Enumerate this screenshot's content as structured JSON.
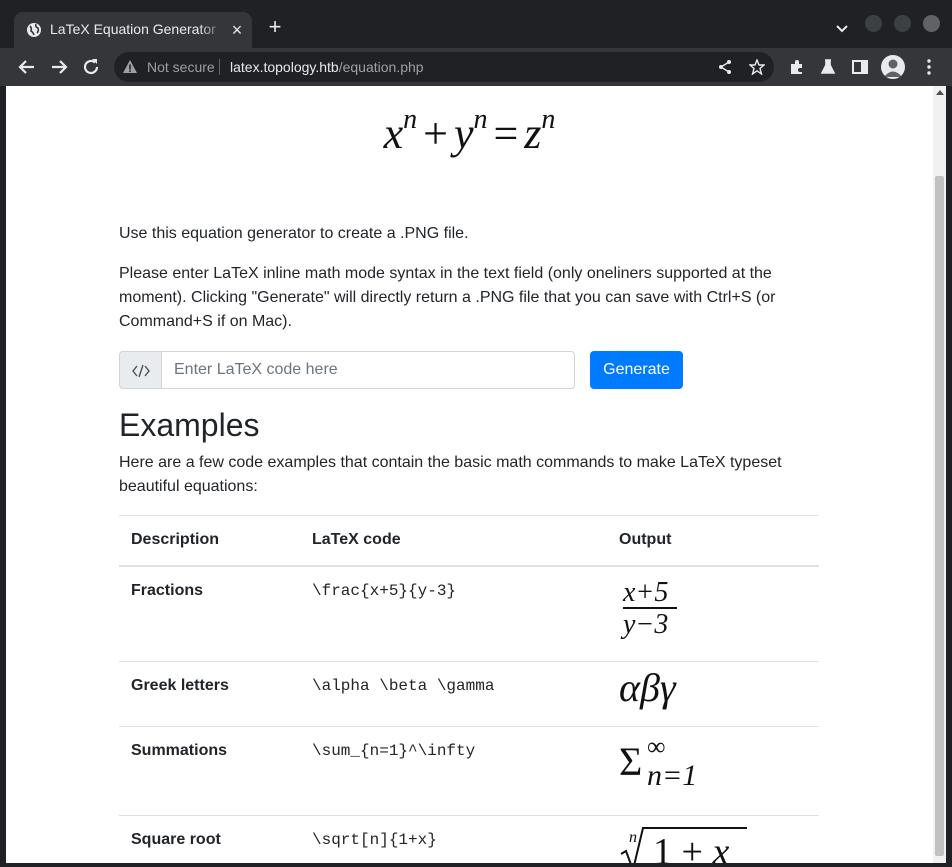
{
  "browser": {
    "tab_title": "LaTeX Equation Generator",
    "security_label": "Not secure",
    "url_host": "latex.topology.htb",
    "url_path": "/equation.php"
  },
  "page": {
    "intro": "Use this equation generator to create a .PNG file.",
    "instructions": "Please enter LaTeX inline math mode syntax in the text field (only oneliners supported at the moment). Clicking \"Generate\" will directly return a .PNG file that you can save with Ctrl+S (or Command+S if on Mac).",
    "input_placeholder": "Enter LaTeX code here",
    "generate_label": "Generate",
    "examples_heading": "Examples",
    "examples_intro": "Here are a few code examples that contain the basic math commands to make LaTeX typeset beautiful equations:"
  },
  "table": {
    "headers": [
      "Description",
      "LaTeX code",
      "Output"
    ],
    "rows": [
      {
        "description": "Fractions",
        "code": "\\frac{x+5}{y-3}"
      },
      {
        "description": "Greek letters",
        "code": "\\alpha \\beta \\gamma"
      },
      {
        "description": "Summations",
        "code": "\\sum_{n=1}^\\infty"
      },
      {
        "description": "Square root",
        "code": "\\sqrt[n]{1+x}"
      }
    ]
  },
  "colors": {
    "primary": "#007bff",
    "chrome_dark": "#202124",
    "chrome_toolbar": "#35363a"
  }
}
